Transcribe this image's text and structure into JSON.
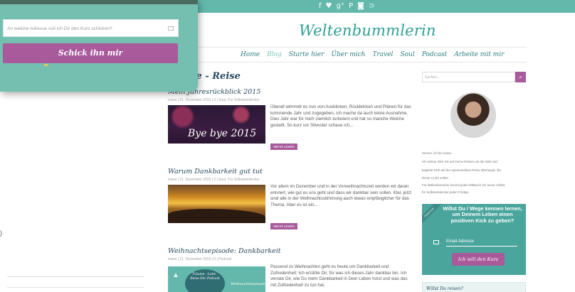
{
  "topbar": {
    "social_icons": [
      "f",
      "♥",
      "g⁺",
      "P",
      "◙",
      "⊃"
    ]
  },
  "header": {
    "site_title": "Weltenbummlerin"
  },
  "nav": {
    "items": [
      {
        "label": "Home"
      },
      {
        "label": "Blog"
      },
      {
        "label": "Starte hier"
      },
      {
        "label": "Über mich"
      },
      {
        "label": "Travel"
      },
      {
        "label": "Soul"
      },
      {
        "label": "Podcast"
      },
      {
        "label": "Arbeite mit mir"
      }
    ]
  },
  "main": {
    "section_title": "– Lebe - Reise",
    "posts": [
      {
        "title": "Mein Jahresrückblick 2015",
        "meta": "Ivana  |  31. Dezember 2015  |  3  |  Soul, Für Selbstentdecker",
        "thumb_text": "Bye bye 2015",
        "excerpt": "Überall wimmelt es nun von Ausblicken, Rückblicken und Plänen für das kommende Jahr und zugegeben, ich mache da auch keine Ausnahme. Dies Jahr war für mich ziemlich turbulent und hat so manche Weiche gestellt. So kurz vor Silvester schaue ich...",
        "more_label": "MEHR LESEN"
      },
      {
        "title": "Warum Dankbarkeit gut tut",
        "meta": "Ivana  |  21. Dezember 2015  |  2  |  Soul, Für Selbstentdecker",
        "excerpt": "Vor allem im Dezember und in der Vorweihnachtszeit werden wir daran erinnert, wie gut es uns geht und dass wir dankbar sein sollen. Klar, jetzt sind alle in der Weihnachtsstimmung auch etwas empfänglicher für das Thema. Aber es ist ein...",
        "more_label": "MEHR LESEN"
      },
      {
        "title": "Weihnachtsepisode: Dankbarkeit",
        "meta": "Ivana  |  21. Dezember 2015  |  0  |  Podcast",
        "thumb_title": "Träume - Lebe - Reise Der Podcast",
        "thumb_right": "Weihnachtsepisode",
        "excerpt": "Passend zu Weihnachten geht es heute um Dankbarkeit und Zufriedenheit: Ich erzähle Dir, für was ich dieses Jahr dankbar bin. Ich verrate Dir, wie Du mehr Dankbarkeit in Dein Leben holst und was das mit Zufriedenheit zu tun hat."
      }
    ]
  },
  "sidebar": {
    "search_placeholder": "Suchen...",
    "search_icon_glyph": "⌕",
    "bio_lines": [
      "Servus, ich bin Ivana.",
      "Ich nehme Dich mit auf meine Reisen um die Welt und",
      "begleite Dich auf der spannendsten Reise überhaupt, der",
      "Reise zu Dir selbst.",
      "Für Weltenbummler kommt jeden Mittwoch ein neuer Artikel,",
      "für Selbstentdecker jeden Freitag."
    ],
    "cta": {
      "ribbon": "Gratis Kurs",
      "headline": "Willst Du / Wege kennen lernen, um Deinem Leben einen positiven Kick zu geben?",
      "email_label": "Email-Adresse",
      "button_label": "Ich will den Kurs"
    },
    "widget2_title": "Willst Du reisen?"
  },
  "popup": {
    "field_placeholder": "An welche Adresse soll ich Dir den Kurs schicken?",
    "button_label": "Schick ihn mir"
  },
  "left": {
    "mark": ")"
  },
  "colors": {
    "teal": "#63b8ab",
    "purple": "#a85a9b",
    "title_teal": "#2f9f96",
    "dark_text": "#2a4a5f"
  }
}
